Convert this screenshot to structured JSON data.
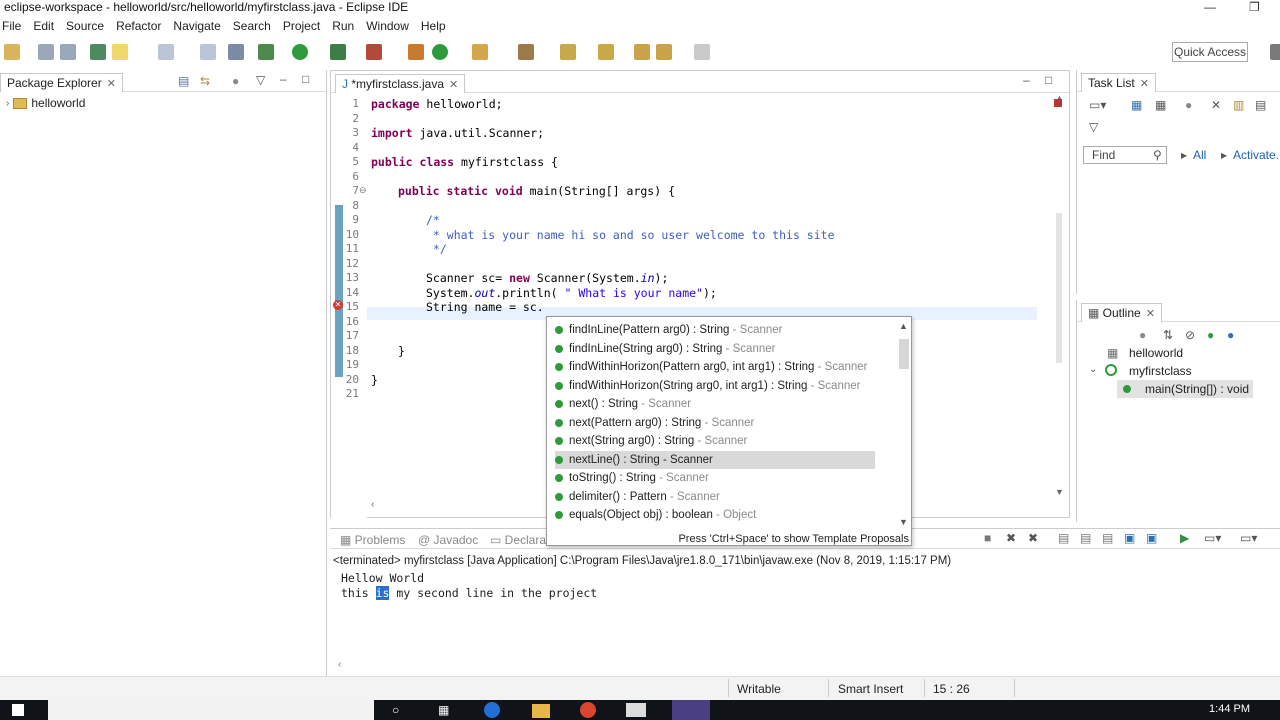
{
  "window": {
    "title": "eclipse-workspace - helloworld/src/helloworld/myfirstclass.java - Eclipse IDE",
    "minimize": "—",
    "maximize": "❐"
  },
  "menu": [
    "File",
    "Edit",
    "Source",
    "Refactor",
    "Navigate",
    "Search",
    "Project",
    "Run",
    "Window",
    "Help"
  ],
  "toolbar": {
    "quick_access": "Quick Access"
  },
  "package_explorer": {
    "tab_label": "Package Explorer",
    "project": "helloworld"
  },
  "editor": {
    "tab_label": "*myfirstclass.java",
    "line_numbers": [
      "1",
      "2",
      "3",
      "4",
      "5",
      "6",
      "7",
      "8",
      "9",
      "10",
      "11",
      "12",
      "13",
      "14",
      "15",
      "16",
      "17",
      "18",
      "19",
      "20",
      "21"
    ],
    "lines": {
      "l1_kw": "package",
      "l1_rest": " helloworld;",
      "l3_kw": "import",
      "l3_rest": " java.util.Scanner;",
      "l5_kw1": "public",
      "l5_kw2": "class",
      "l5_rest": " myfirstclass {",
      "l7_kw1": "public",
      "l7_kw2": "static",
      "l7_kw3": "void",
      "l7_rest": " main(String[] args) {",
      "l9": "/*",
      "l10": " * what is your name hi so and so user welcome to this site",
      "l11": " */",
      "l13_a": "Scanner sc= ",
      "l13_kw": "new",
      "l13_b": " Scanner(System.",
      "l13_it": "in",
      "l13_c": ");",
      "l14_a": "System.",
      "l14_it": "out",
      "l14_b": ".println( ",
      "l14_st": "\" What is your name\"",
      "l14_c": ");",
      "l15": "String name = sc.",
      "l18": "}",
      "l20": "}"
    }
  },
  "content_assist": {
    "items": [
      {
        "sig": "findInLine(Pattern arg0) : String",
        "src": " - Scanner"
      },
      {
        "sig": "findInLine(String arg0) : String",
        "src": " - Scanner"
      },
      {
        "sig": "findWithinHorizon(Pattern arg0, int arg1) : String",
        "src": " - Scanner"
      },
      {
        "sig": "findWithinHorizon(String arg0, int arg1) : String",
        "src": " - Scanner"
      },
      {
        "sig": "next() : String",
        "src": " - Scanner"
      },
      {
        "sig": "next(Pattern arg0) : String",
        "src": " - Scanner"
      },
      {
        "sig": "next(String arg0) : String",
        "src": " - Scanner"
      },
      {
        "sig": "nextLine() : String - Scanner",
        "src": ""
      },
      {
        "sig": "toString() : String",
        "src": " - Scanner"
      },
      {
        "sig": "delimiter() : Pattern",
        "src": " - Scanner"
      },
      {
        "sig": "equals(Object obj) : boolean",
        "src": " - Object"
      }
    ],
    "selected_index": 7,
    "footer": "Press 'Ctrl+Space' to show Template Proposals"
  },
  "console": {
    "tabs": [
      "Problems",
      "Javadoc",
      "Declaratio"
    ],
    "header": "<terminated> myfirstclass [Java Application] C:\\Program Files\\Java\\jre1.8.0_171\\bin\\javaw.exe (Nov 8, 2019, 1:15:17 PM)",
    "line1": "Hellow World",
    "line2_a": "this ",
    "line2_hl": "is",
    "line2_b": " my second line in the project"
  },
  "task_list": {
    "tab_label": "Task List",
    "find_placeholder": "Find",
    "all": "All",
    "activate": "Activate..."
  },
  "outline": {
    "tab_label": "Outline",
    "package": "helloworld",
    "class": "myfirstclass",
    "method": "main(String[]) : void"
  },
  "status": {
    "writable": "Writable",
    "insert_mode": "Smart Insert",
    "position": "15 : 26"
  },
  "taskbar": {
    "clock": "1:44 PM"
  },
  "colors": {
    "accent": "#6aa3c0",
    "keyword": "#7f0055",
    "comment": "#3f5fbf",
    "string": "#2a00ff"
  }
}
